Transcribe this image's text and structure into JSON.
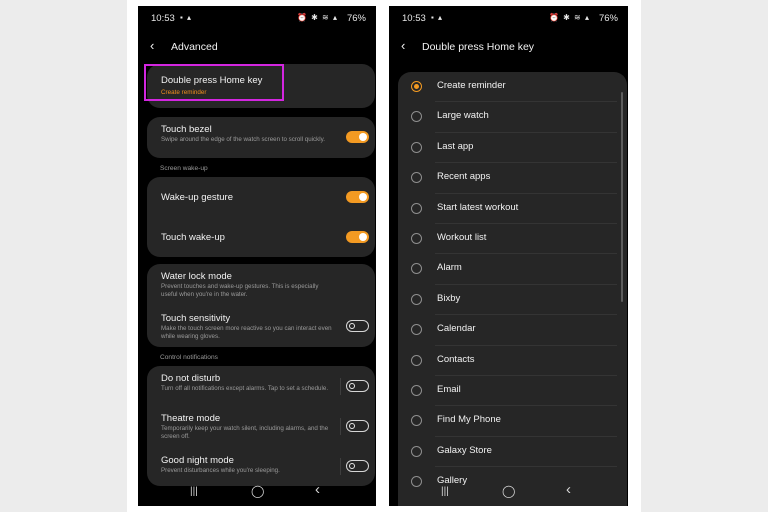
{
  "left_screen": {
    "status": {
      "time": "10:53",
      "left_icons": "▪ ▴",
      "right_icons": "⏰ ✱ ≋ ▴",
      "battery": "76%"
    },
    "header": {
      "back_icon": "chevron-left-icon",
      "title": "Advanced"
    },
    "double_press": {
      "title": "Double press Home key",
      "subtitle": "Create reminder"
    },
    "touch_bezel": {
      "title": "Touch bezel",
      "desc": "Swipe around the edge of the watch screen to scroll quickly.",
      "toggle": "on"
    },
    "screen_wakeup_header": "Screen wake-up",
    "wakeup_gesture": {
      "title": "Wake-up gesture",
      "toggle": "on"
    },
    "touch_wakeup": {
      "title": "Touch wake-up",
      "toggle": "on"
    },
    "water_lock": {
      "title": "Water lock mode",
      "desc": "Prevent touches and wake-up gestures. This is especially useful when you're in the water."
    },
    "touch_sensitivity": {
      "title": "Touch sensitivity",
      "desc": "Make the touch screen more reactive so you can interact even while wearing gloves.",
      "toggle": "off"
    },
    "control_notifications_header": "Control notifications",
    "do_not_disturb": {
      "title": "Do not disturb",
      "desc": "Turn off all notifications except alarms. Tap to set a schedule.",
      "toggle": "off"
    },
    "theatre_mode": {
      "title": "Theatre mode",
      "desc": "Temporarily keep your watch silent, including alarms, and the screen off.",
      "toggle": "off"
    },
    "good_night_mode": {
      "title": "Good night mode",
      "desc": "Prevent disturbances while you're sleeping.",
      "toggle": "off"
    },
    "nav": {
      "recents": "|||",
      "home": "◯",
      "back": "‹"
    }
  },
  "right_screen": {
    "status": {
      "time": "10:53",
      "left_icons": "▪ ▴",
      "right_icons": "⏰ ✱ ≋ ▴",
      "battery": "76%"
    },
    "header": {
      "back_icon": "chevron-left-icon",
      "title": "Double press Home key"
    },
    "options": [
      "Create reminder",
      "Large watch",
      "Last app",
      "Recent apps",
      "Start latest workout",
      "Workout list",
      "Alarm",
      "Bixby",
      "Calendar",
      "Contacts",
      "Email",
      "Find My Phone",
      "Galaxy Store",
      "Gallery"
    ],
    "selected_index": 0,
    "nav": {
      "recents": "|||",
      "home": "◯",
      "back": "‹"
    }
  },
  "colors": {
    "accent": "#f39a22",
    "highlight_border": "#d326e0",
    "card": "#262626",
    "background": "#000000"
  }
}
